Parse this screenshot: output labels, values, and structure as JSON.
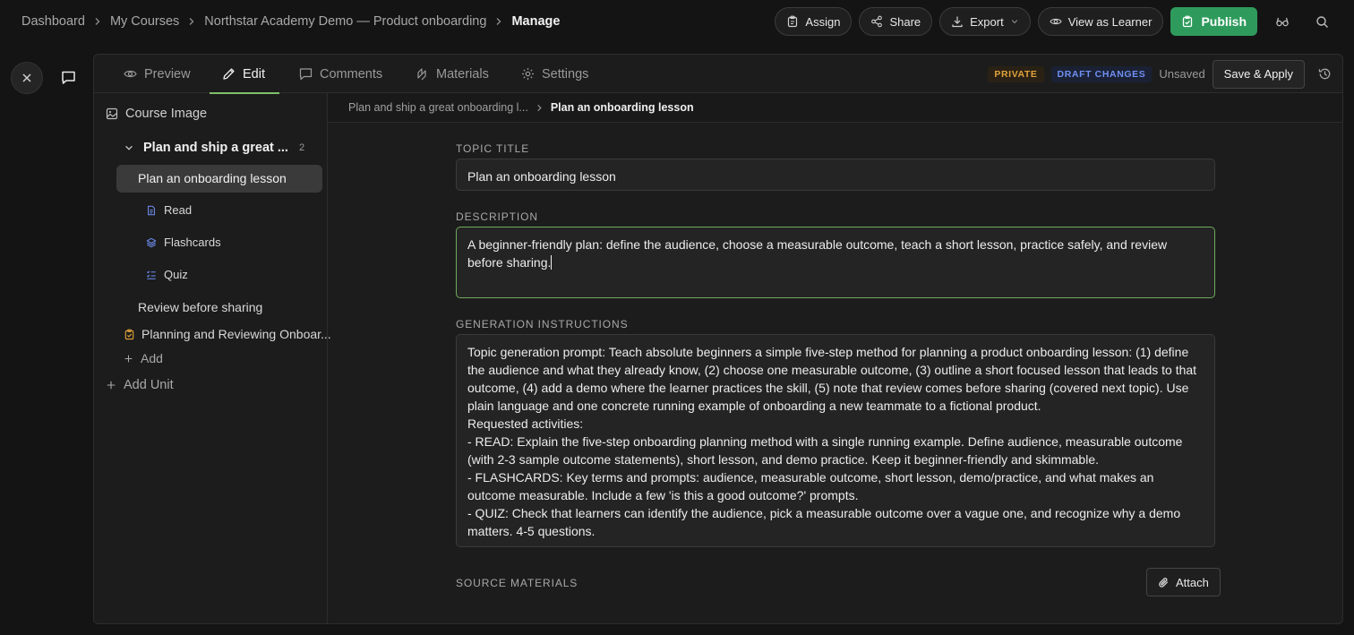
{
  "breadcrumbs": [
    "Dashboard",
    "My Courses",
    "Northstar Academy Demo — Product onboarding",
    "Manage"
  ],
  "header_actions": {
    "assign": "Assign",
    "share": "Share",
    "export": "Export",
    "view_as_learner": "View as Learner",
    "publish": "Publish"
  },
  "tabs": [
    {
      "label": "Preview",
      "icon": "eye-icon"
    },
    {
      "label": "Edit",
      "icon": "pencil-icon",
      "active": true
    },
    {
      "label": "Comments",
      "icon": "comment-icon"
    },
    {
      "label": "Materials",
      "icon": "materials-icon"
    },
    {
      "label": "Settings",
      "icon": "gear-icon"
    }
  ],
  "status": {
    "private": "PRIVATE",
    "draft_changes": "DRAFT CHANGES",
    "unsaved": "Unsaved",
    "save_apply": "Save & Apply"
  },
  "sidebar": {
    "course_image": "Course Image",
    "unit": {
      "title": "Plan and ship a great ...",
      "count": "2"
    },
    "topics": [
      {
        "label": "Plan an onboarding lesson",
        "selected": true
      },
      {
        "label": "Read",
        "icon": "document-icon"
      },
      {
        "label": "Flashcards",
        "icon": "layers-icon"
      },
      {
        "label": "Quiz",
        "icon": "checklist-icon"
      },
      {
        "label": "Review before sharing"
      },
      {
        "label": "Planning and Reviewing Onboar...",
        "icon": "clipboard-icon"
      }
    ],
    "add": "Add",
    "add_unit": "Add Unit"
  },
  "content_breadcrumb": {
    "parent": "Plan and ship a great onboarding l...",
    "current": "Plan an onboarding lesson"
  },
  "form": {
    "topic_title_label": "TOPIC TITLE",
    "topic_title_value": "Plan an onboarding lesson",
    "description_label": "DESCRIPTION",
    "description_value": "A beginner-friendly plan: define the audience, choose a measurable outcome, teach a short lesson, practice safely, and review before sharing.",
    "generation_label": "GENERATION INSTRUCTIONS",
    "generation_value": "Topic generation prompt: Teach absolute beginners a simple five-step method for planning a product onboarding lesson: (1) define the audience and what they already know, (2) choose one measurable outcome, (3) outline a short focused lesson that leads to that outcome, (4) add a demo where the learner practices the skill, (5) note that review comes before sharing (covered next topic). Use plain language and one concrete running example of onboarding a new teammate to a fictional product.\nRequested activities:\n- READ: Explain the five-step onboarding planning method with a single running example. Define audience, measurable outcome (with 2-3 sample outcome statements), short lesson, and demo practice. Keep it beginner-friendly and skimmable.\n- FLASHCARDS: Key terms and prompts: audience, measurable outcome, short lesson, demo/practice, and what makes an outcome measurable. Include a few 'is this a good outcome?' prompts.\n- QUIZ: Check that learners can identify the audience, pick a measurable outcome over a vague one, and recognize why a demo matters. 4-5 questions.",
    "source_materials_label": "SOURCE MATERIALS",
    "attach": "Attach"
  },
  "colors": {
    "publish": "#2e9b5c",
    "active_tab_underline": "#7fbf6a",
    "focus_border": "#6fa95b",
    "private_badge": "#e0a23a",
    "draft_badge": "#6f8ff2"
  }
}
